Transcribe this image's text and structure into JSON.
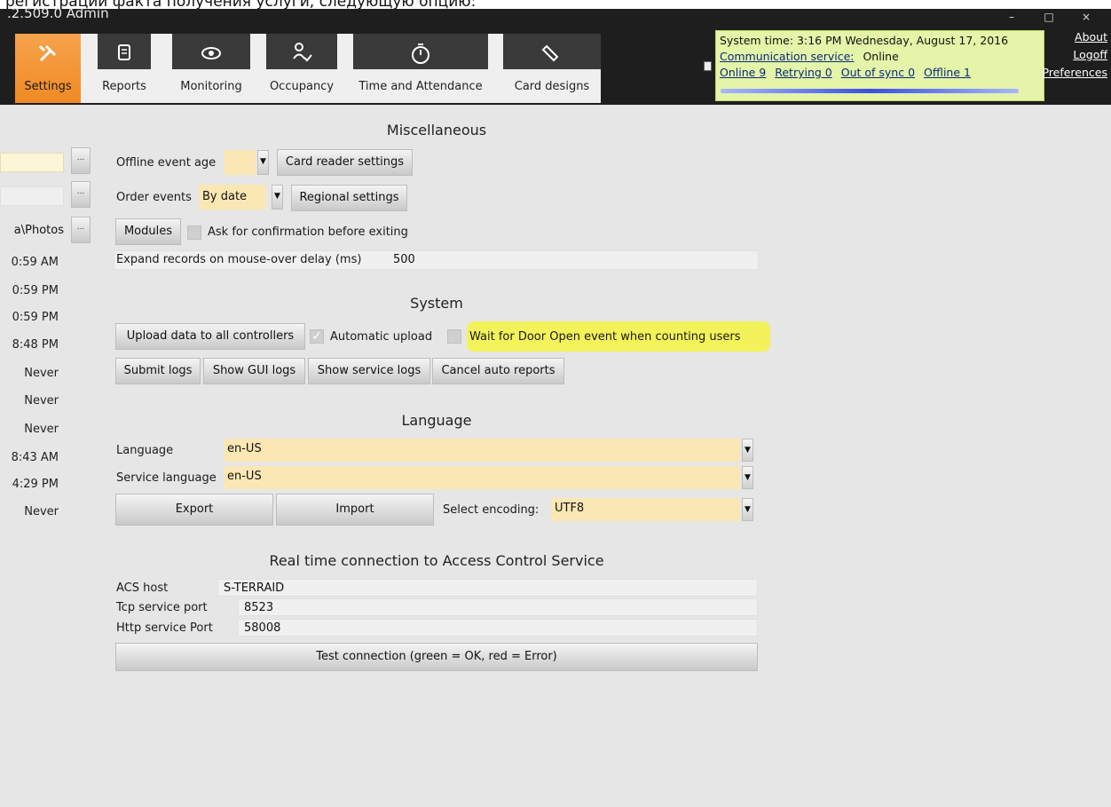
{
  "caption": "регистрации факта получения услуги, следующую опцию:",
  "window": {
    "title": ".2.509.0 Admin",
    "min": "–",
    "max": "□",
    "close": "×"
  },
  "tabs": [
    {
      "label": "Settings",
      "icon": "wrench-screwdriver-icon",
      "glyph": "✂"
    },
    {
      "label": "Reports",
      "icon": "documents-icon",
      "glyph": "▤"
    },
    {
      "label": "Monitoring",
      "icon": "eye-icon",
      "glyph": "◉"
    },
    {
      "label": "Occupancy",
      "icon": "person-check-icon",
      "glyph": "♗"
    },
    {
      "label": "Time and Attendance",
      "icon": "stopwatch-icon",
      "glyph": "◷"
    },
    {
      "label": "Card designs",
      "icon": "card-icon",
      "glyph": "▧"
    }
  ],
  "status": {
    "system_time_label": "System time:",
    "system_time": "3:16 PM Wednesday, August 17, 2016",
    "comm_label": "Communication service:",
    "comm_value": "Online",
    "online": "Online 9",
    "retrying": "Retrying 0",
    "out_of_sync": "Out of sync 0",
    "offline": "Offline 1"
  },
  "top_links": {
    "about": "About",
    "logoff": "Logoff",
    "preferences": "Preferences"
  },
  "left_column": {
    "photos_path": "a\\Photos",
    "ellipsis": "...",
    "values": [
      "0:59 AM",
      "0:59 PM",
      "0:59 PM",
      "8:48 PM",
      "Never",
      "Never",
      "Never",
      "8:43 AM",
      "4:29 PM",
      "Never"
    ]
  },
  "misc": {
    "title": "Miscellaneous",
    "offline_event_age_label": "Offline event age",
    "offline_event_age_value": "",
    "card_reader_settings": "Card reader settings",
    "order_events_label": "Order events",
    "order_events_value": "By date",
    "regional_settings": "Regional settings",
    "modules": "Modules",
    "ask_confirm_label": "Ask for confirmation before exiting",
    "expand_delay_label": "Expand records on mouse-over delay (ms)",
    "expand_delay_value": "500"
  },
  "system": {
    "title": "System",
    "upload_all": "Upload data to all controllers",
    "automatic_upload": "Automatic upload",
    "automatic_upload_checked": true,
    "wait_door_open": "Wait for Door Open event when counting users",
    "wait_door_open_checked": false,
    "submit_logs": "Submit logs",
    "show_gui_logs": "Show GUI logs",
    "show_service_logs": "Show service logs",
    "cancel_auto_reports": "Cancel auto reports",
    "highlight_color": "#f3f25a"
  },
  "language": {
    "title": "Language",
    "language_label": "Language",
    "language_value": "en-US",
    "service_language_label": "Service language",
    "service_language_value": "en-US",
    "export": "Export",
    "import": "Import",
    "encoding_label": "Select encoding:",
    "encoding_value": "UTF8"
  },
  "rtc": {
    "title": "Real time connection to Access Control Service",
    "acs_host_label": "ACS host",
    "acs_host_value": "S-TERRAID",
    "tcp_port_label": "Tcp service port",
    "tcp_port_value": "8523",
    "http_port_label": "Http service Port",
    "http_port_value": "58008",
    "test_connection": "Test connection (green = OK, red = Error)"
  },
  "colors": {
    "accent_orange": "#f08a24",
    "field_yellow": "#fbe7b4",
    "status_green": "#e4f4a8"
  }
}
